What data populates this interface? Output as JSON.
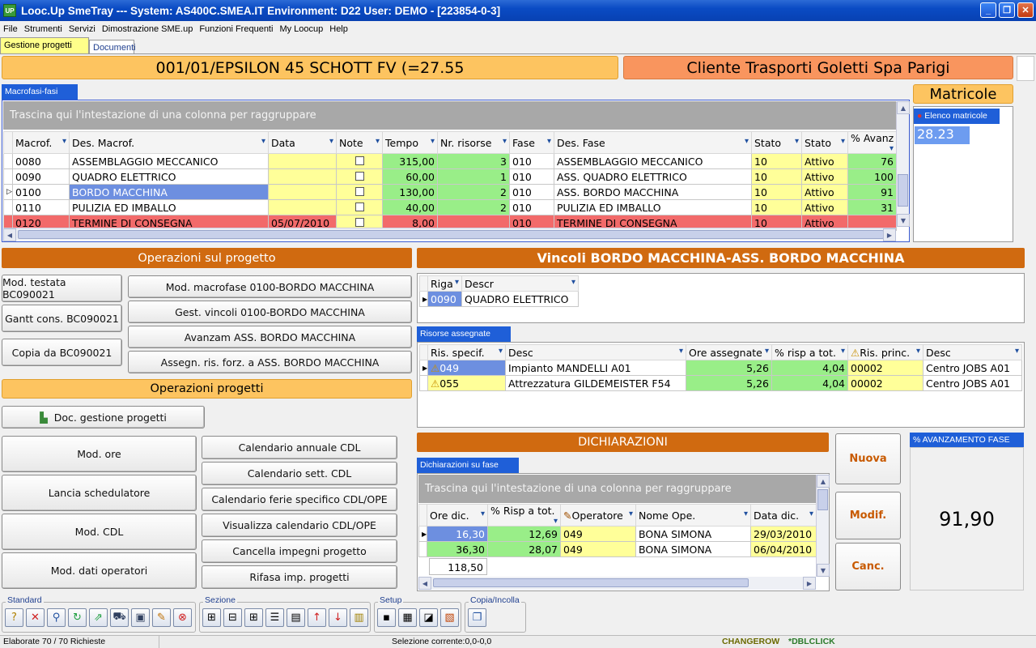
{
  "window": {
    "app_icon_text": "UP",
    "title": "Looc.Up SmeTray --- System: AS400C.SMEA.IT Environment: D22 User: DEMO - [223854-0-3]",
    "min_glyph": "_",
    "max_glyph": "❐",
    "close_glyph": "✕"
  },
  "menu": [
    "File",
    "Strumenti",
    "Servizi",
    "Dimostrazione SME.up",
    "Funzioni Frequenti",
    "My Loocup",
    "Help"
  ],
  "top_tabs": {
    "active": "Gestione progetti",
    "other": "Documenti"
  },
  "header": {
    "project": "001/01/EPSILON 45 SCHOTT FV (=27.55",
    "client": "Cliente Trasporti Goletti Spa Parigi",
    "matricole_title": "Matricole",
    "elenco_tab": "Elenco matricole",
    "matricola_value": "28.23"
  },
  "macrofasi": {
    "tab": "Macrofasi-fasi",
    "group_hint": "Trascina qui l'intestazione di una colonna per raggruppare",
    "columns": [
      "Macrof.",
      "Des. Macrof.",
      "Data",
      "Note",
      "Tempo",
      "Nr. risorse",
      "Fase",
      "Des. Fase",
      "Stato",
      "Stato",
      "% Avanz"
    ],
    "rows": [
      {
        "macrof": "0080",
        "des": "ASSEMBLAGGIO MECCANICO",
        "data": "",
        "tempo": "315,00",
        "nr": "3",
        "fase": "010",
        "desfase": "ASSEMBLAGGIO MECCANICO",
        "stato": "10",
        "stato2": "Attivo",
        "avanz": "76"
      },
      {
        "macrof": "0090",
        "des": "QUADRO ELETTRICO",
        "data": "",
        "tempo": "60,00",
        "nr": "1",
        "fase": "010",
        "desfase": "ASS. QUADRO ELETTRICO",
        "stato": "10",
        "stato2": "Attivo",
        "avanz": "100"
      },
      {
        "macrof": "0100",
        "des": "BORDO MACCHINA",
        "data": "",
        "tempo": "130,00",
        "nr": "2",
        "fase": "010",
        "desfase": "ASS. BORDO MACCHINA",
        "stato": "10",
        "stato2": "Attivo",
        "avanz": "91"
      },
      {
        "macrof": "0110",
        "des": "PULIZIA ED IMBALLO",
        "data": "",
        "tempo": "40,00",
        "nr": "2",
        "fase": "010",
        "desfase": "PULIZIA ED IMBALLO",
        "stato": "10",
        "stato2": "Attivo",
        "avanz": "31"
      },
      {
        "macrof": "0120",
        "des": "TERMINE DI CONSEGNA",
        "data": "05/07/2010",
        "tempo": "8,00",
        "nr": "",
        "fase": "010",
        "desfase": "TERMINE DI CONSEGNA",
        "stato": "10",
        "stato2": "Attivo",
        "avanz": ""
      }
    ]
  },
  "operazioni_progetto": {
    "title": "Operazioni sul progetto",
    "left_buttons": [
      "Mod. testata BC090021",
      "Gantt cons. BC090021",
      "Copia da BC090021"
    ],
    "right_buttons": [
      "Mod. macrofase 0100-BORDO MACCHINA",
      "Gest. vincoli 0100-BORDO MACCHINA",
      "Avanzam ASS. BORDO MACCHINA",
      "Assegn. ris. forz. a ASS. BORDO MACCHINA"
    ]
  },
  "operazioni_progetti": {
    "title": "Operazioni progetti",
    "doc_button": "Doc. gestione progetti",
    "left_buttons": [
      "Mod. ore",
      "Lancia schedulatore",
      "Mod. CDL",
      "Mod. dati operatori"
    ],
    "right_buttons": [
      "Calendario annuale CDL",
      "Calendario sett. CDL",
      "Calendario ferie specifico CDL/OPE",
      "Visualizza calendario CDL/OPE",
      "Cancella impegni progetto",
      "Rifasa imp. progetti"
    ]
  },
  "vincoli": {
    "title": "Vincoli BORDO MACCHINA-ASS. BORDO MACCHINA",
    "columns": [
      "Riga",
      "Descr"
    ],
    "rows": [
      {
        "riga": "0090",
        "descr": "QUADRO ELETTRICO"
      }
    ]
  },
  "risorse": {
    "tab": "Risorse assegnate",
    "columns": [
      "Ris. specif.",
      "Desc",
      "Ore assegnate",
      "% risp a tot.",
      "Ris. princ.",
      "Desc"
    ],
    "rows": [
      {
        "ris": "049",
        "desc": "Impianto MANDELLI A01",
        "ore": "5,26",
        "risp": "4,04",
        "princ": "00002",
        "desc2": "Centro JOBS A01"
      },
      {
        "ris": "055",
        "desc": "Attrezzatura GILDEMEISTER F54",
        "ore": "5,26",
        "risp": "4,04",
        "princ": "00002",
        "desc2": "Centro JOBS A01"
      }
    ]
  },
  "dichiarazioni": {
    "title": "DICHIARAZIONI",
    "tab": "Dichiarazioni su fase",
    "group_hint": "Trascina qui l'intestazione di una colonna per raggruppare",
    "columns": [
      "Ore dic.",
      "% Risp a tot.",
      "Operatore",
      "Nome Ope.",
      "Data dic."
    ],
    "rows": [
      {
        "ore": "16,30",
        "risp": "12,69",
        "op": "049",
        "nome": "BONA SIMONA",
        "data": "29/03/2010"
      },
      {
        "ore": "36,30",
        "risp": "28,07",
        "op": "049",
        "nome": "BONA SIMONA",
        "data": "06/04/2010"
      }
    ],
    "total": "118,50"
  },
  "side_buttons": {
    "nuova": "Nuova",
    "modif": "Modif.",
    "canc": "Canc."
  },
  "avanzamento": {
    "tab": "% AVANZAMENTO FASE",
    "value": "91,90"
  },
  "toolbar": {
    "standard": "Standard",
    "sezione": "Sezione",
    "setup": "Setup",
    "copia": "Copia/Incolla"
  },
  "status": {
    "elaborate": "Elaborate 70 / 70 Richieste",
    "selezione": "Selezione corrente:0,0-0,0",
    "changerow": "CHANGEROW",
    "dblclick": "*DBLCLICK"
  },
  "colors": {
    "accent_orange": "#d06a10",
    "header_orange": "#fdc460",
    "header_salmon": "#f9955e",
    "title_blue": "#0a4bc4",
    "cell_yellow": "#ffff99",
    "cell_green": "#99ee88",
    "cell_red": "#f26a6a",
    "selection_blue": "#6d8fe0"
  }
}
